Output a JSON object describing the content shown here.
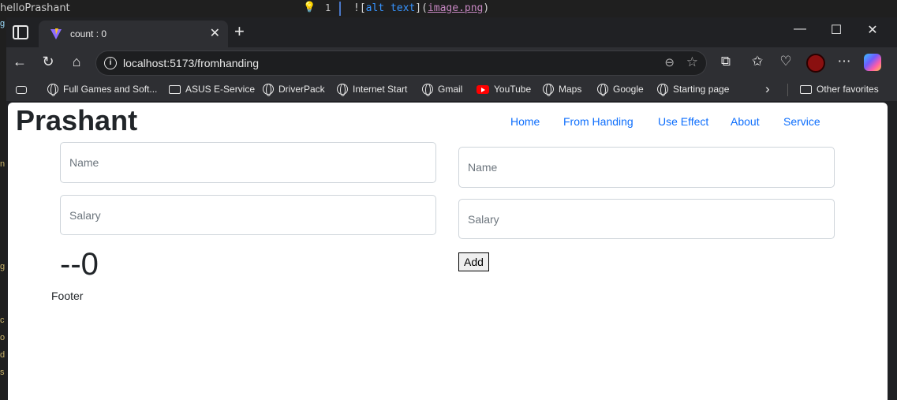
{
  "vscode": {
    "explorer_item": "helloPrashant",
    "line_number": "1",
    "code_bang": "![",
    "code_alt": "alt text",
    "code_mid": "](",
    "code_url": "image.png",
    "code_end": ")"
  },
  "browser": {
    "tab_title": "count : 0",
    "url": "localhost:5173/fromhanding",
    "favorites": [
      "Full Games and Soft...",
      "ASUS E-Service",
      "DriverPack",
      "Internet Start",
      "Gmail",
      "YouTube",
      "Maps",
      "Google",
      "Starting page"
    ],
    "other_favorites": "Other favorites"
  },
  "page": {
    "brand": "Prashant",
    "nav": [
      "Home",
      "From Handing",
      "Use Effect",
      "About",
      "Service"
    ],
    "left_form": {
      "name_placeholder": "Name",
      "salary_placeholder": "Salary"
    },
    "right_form": {
      "name_placeholder": "Name",
      "salary_placeholder": "Salary",
      "add_label": "Add"
    },
    "counter_text": "--0",
    "footer_text": "Footer"
  },
  "colors": {
    "link": "#0d6efd",
    "youtube_red": "#ff0000"
  }
}
